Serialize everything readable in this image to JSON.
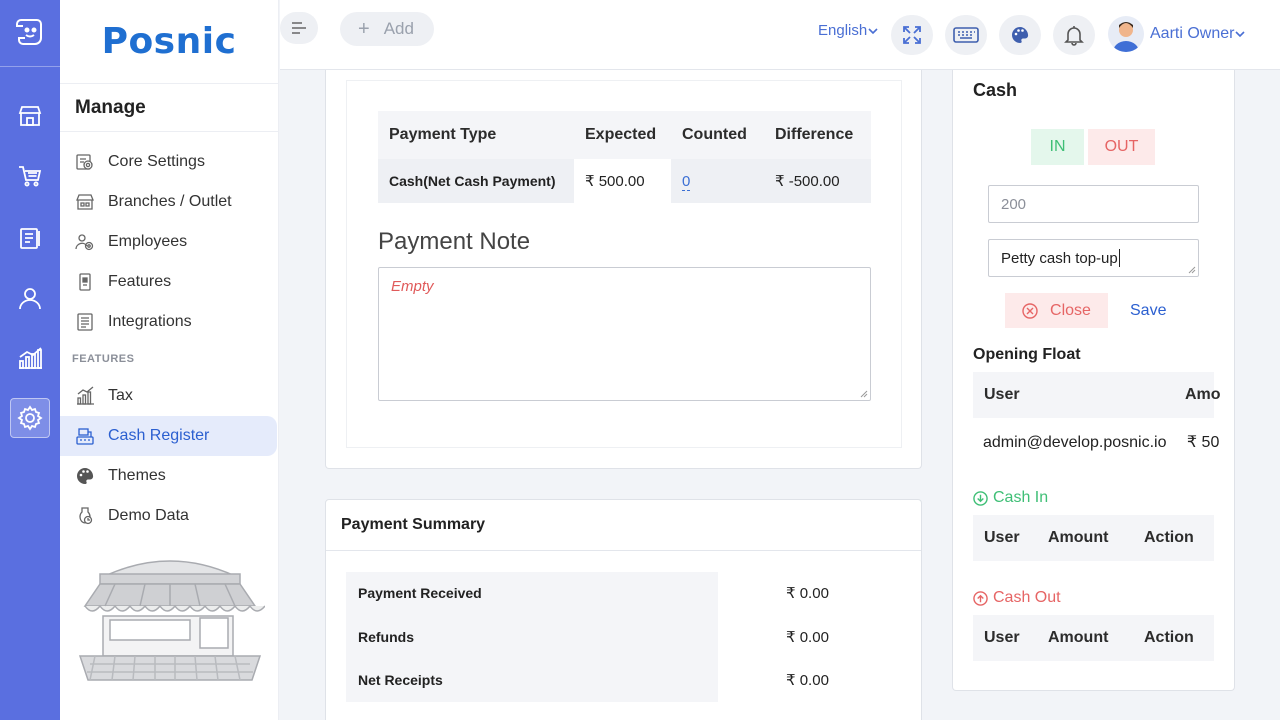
{
  "brand": {
    "name": "Posnic"
  },
  "rail": {
    "items": [
      {
        "icon": "store-icon"
      },
      {
        "icon": "cart-icon"
      },
      {
        "icon": "clipboard-icon"
      },
      {
        "icon": "user-icon"
      },
      {
        "icon": "chart-icon"
      },
      {
        "icon": "gear-icon",
        "active": true
      }
    ]
  },
  "sidebar": {
    "title": "Manage",
    "items": [
      {
        "label": "Core Settings",
        "icon": "settings-doc-icon"
      },
      {
        "label": "Branches / Outlet",
        "icon": "branch-icon"
      },
      {
        "label": "Employees",
        "icon": "employees-icon"
      },
      {
        "label": "Features",
        "icon": "features-icon"
      },
      {
        "label": "Integrations",
        "icon": "integrations-icon"
      }
    ],
    "section_heading": "FEATURES",
    "feature_items": [
      {
        "label": "Tax",
        "icon": "tax-icon"
      },
      {
        "label": "Cash Register",
        "icon": "cash-register-icon",
        "active": true
      },
      {
        "label": "Themes",
        "icon": "palette-icon"
      },
      {
        "label": "Demo Data",
        "icon": "demo-data-icon"
      }
    ]
  },
  "topbar": {
    "add_label": "Add",
    "language": "English",
    "user_name": "Aarti Owner"
  },
  "payment_table": {
    "headers": [
      "Payment Type",
      "Expected",
      "Counted",
      "Difference"
    ],
    "rows": [
      {
        "type": "Cash(Net Cash Payment)",
        "expected": "₹ 500.00",
        "counted": "0",
        "difference": "₹ -500.00"
      }
    ]
  },
  "payment_note": {
    "title": "Payment Note",
    "placeholder": "Empty"
  },
  "payment_summary": {
    "title": "Payment Summary",
    "rows": [
      {
        "label": "Payment Received",
        "value": "₹  0.00"
      },
      {
        "label": "Refunds",
        "value": "₹  0.00"
      },
      {
        "label": "Net Receipts",
        "value": "₹  0.00"
      }
    ]
  },
  "cash_panel": {
    "title": "Cash",
    "in_label": "IN",
    "out_label": "OUT",
    "amount_placeholder": "200",
    "note_value": "Petty cash top-up",
    "close_label": "Close",
    "save_label": "Save",
    "opening_float": {
      "title": "Opening Float",
      "headers": [
        "User",
        "Amo"
      ],
      "row": {
        "user": "admin@develop.posnic.io",
        "amount": "₹ 50"
      }
    },
    "cash_in": {
      "title": "Cash In",
      "headers": [
        "User",
        "Amount",
        "Action"
      ]
    },
    "cash_out": {
      "title": "Cash Out",
      "headers": [
        "User",
        "Amount",
        "Action"
      ]
    }
  },
  "colors": {
    "rail": "#5a6fe0",
    "brand": "#1f6fd1",
    "accent": "#2b5fd0",
    "in_green": "#3fbf76",
    "out_red": "#e66565"
  }
}
